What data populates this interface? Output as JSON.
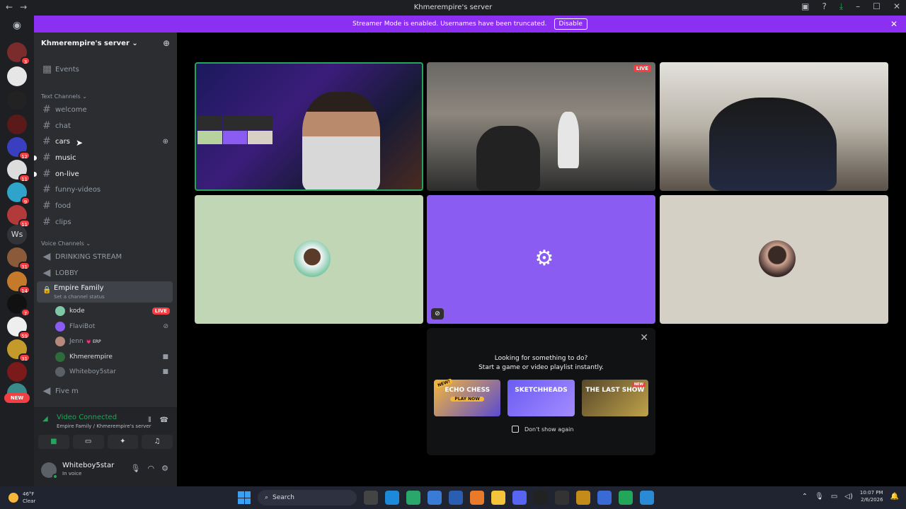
{
  "window": {
    "title": "Khmerempire's server"
  },
  "banner": {
    "text": "Streamer Mode is enabled. Usernames have been truncated.",
    "button": "Disable"
  },
  "rail": {
    "badges": [
      "3",
      "12",
      "11",
      "9",
      "11",
      "31",
      "14",
      "7",
      "59",
      "31"
    ],
    "ws_label": "Ws",
    "new_label": "NEW"
  },
  "server": {
    "name": "Khmerempire's server"
  },
  "channels": {
    "events": "Events",
    "text_category": "Text Channels",
    "text": [
      "welcome",
      "chat",
      "cars",
      "music",
      "on-live",
      "funny-videos",
      "food",
      "clips"
    ],
    "voice_category": "Voice Channels",
    "voice": [
      "DRINKING STREAM",
      "LOBBY"
    ],
    "active_voice": {
      "name": "Empire Family",
      "status": "Set a channel status"
    },
    "members": [
      {
        "name": "kode",
        "live": "LIVE"
      },
      {
        "name": "FlaviBot"
      },
      {
        "name": "Jenn",
        "badge": "💗 ERP"
      },
      {
        "name": "Khmerempire"
      },
      {
        "name": "Whiteboy5star"
      }
    ],
    "after": "Five m"
  },
  "voice_panel": {
    "title": "Video Connected",
    "sub": "Empire Family / Khmerempire's server"
  },
  "user": {
    "name": "Whiteboy5star",
    "status": "In voice"
  },
  "stage": {
    "live_tag": "LIVE"
  },
  "activity": {
    "line1": "Looking for something to do?",
    "line2": "Start a game or video playlist instantly.",
    "cards": [
      {
        "title": "ECHO CHESS",
        "badge": "NEW!",
        "cta": "PLAY NOW"
      },
      {
        "title": "SKETCHHEADS"
      },
      {
        "title": "THE LAST SHOW",
        "badge": "NEW"
      }
    ],
    "dont_show": "Don't show again"
  },
  "taskbar": {
    "temp": "46°F",
    "weather": "Clear",
    "search": "Search",
    "time": "10:07 PM",
    "date": "2/6/2026"
  }
}
